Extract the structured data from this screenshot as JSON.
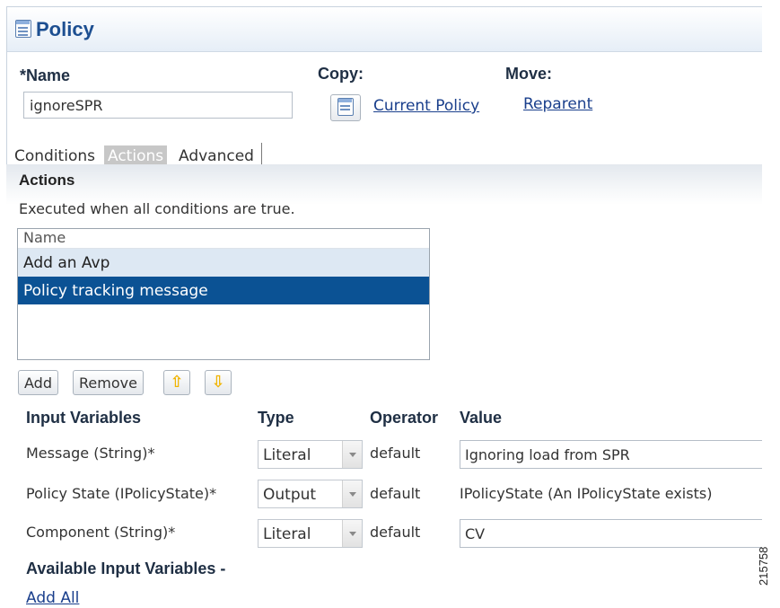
{
  "panel": {
    "title": "Policy"
  },
  "form": {
    "name_label": "*Name",
    "name_value": "ignoreSPR",
    "copy_label": "Copy:",
    "copy_link": "Current Policy",
    "move_label": "Move:",
    "move_link": "Reparent"
  },
  "tabs": [
    {
      "label": "Conditions",
      "active": false
    },
    {
      "label": "Actions",
      "active": true
    },
    {
      "label": "Advanced",
      "active": false
    }
  ],
  "actions": {
    "title": "Actions",
    "description": "Executed when all conditions are true.",
    "list_header": "Name",
    "items": [
      {
        "label": "Add an Avp",
        "state": "hover"
      },
      {
        "label": "Policy tracking message",
        "state": "selected"
      }
    ],
    "buttons": {
      "add": "Add",
      "remove": "Remove",
      "move_up": "⇧",
      "move_down": "⇩"
    }
  },
  "variables": {
    "headers": {
      "input_variables": "Input Variables",
      "type": "Type",
      "operator": "Operator",
      "value": "Value"
    },
    "rows": [
      {
        "label": "Message (String)*",
        "type": "Literal",
        "operator": "default",
        "value": "Ignoring load from SPR",
        "value_kind": "input"
      },
      {
        "label": "Policy State (IPolicyState)*",
        "type": "Output",
        "operator": "default",
        "value": "IPolicyState (An IPolicyState exists)",
        "value_kind": "text"
      },
      {
        "label": "Component (String)*",
        "type": "Literal",
        "operator": "default",
        "value": "CV",
        "value_kind": "input"
      }
    ]
  },
  "available": {
    "title": "Available Input Variables -",
    "add_all": "Add All"
  },
  "figure_id": "215758",
  "colors": {
    "title_blue": "#1d4f91",
    "selected_row": "#0b5294",
    "hover_row": "#dde8f3",
    "active_tab": "#c7c7c7",
    "link": "#1a3f8c"
  }
}
